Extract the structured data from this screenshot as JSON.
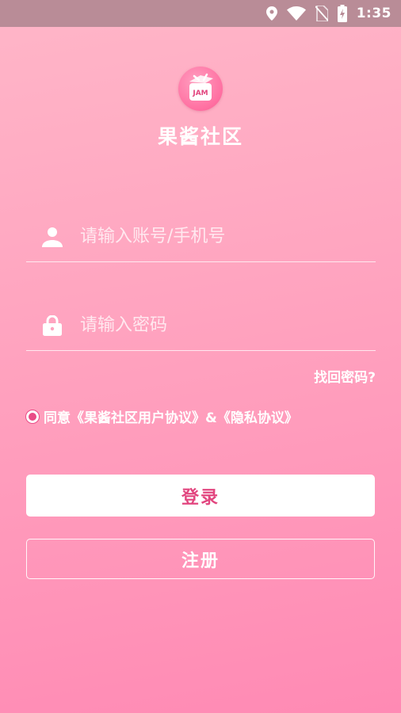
{
  "status_bar": {
    "time": "1:35",
    "icons": [
      "location-icon",
      "wifi-icon",
      "no-sim-icon",
      "battery-charging-icon"
    ]
  },
  "app": {
    "logo_text": "JAM",
    "name": "果酱社区"
  },
  "login_form": {
    "account_placeholder": "请输入账号/手机号",
    "account_value": "",
    "account_icon": "user-icon",
    "password_placeholder": "请输入密码",
    "password_value": "",
    "password_icon": "lock-icon",
    "forgot_password_label": "找回密码?",
    "agreement_text": "同意《果酱社区用户协议》&《隐私协议》",
    "agreement_checked": false,
    "login_label": "登录",
    "register_label": "注册"
  },
  "colors": {
    "status_bar": "#b98c97",
    "background_top": "#ffb6c8",
    "background_bottom": "#ff8ab4",
    "accent": "#e2467f",
    "text": "#ffffff"
  }
}
